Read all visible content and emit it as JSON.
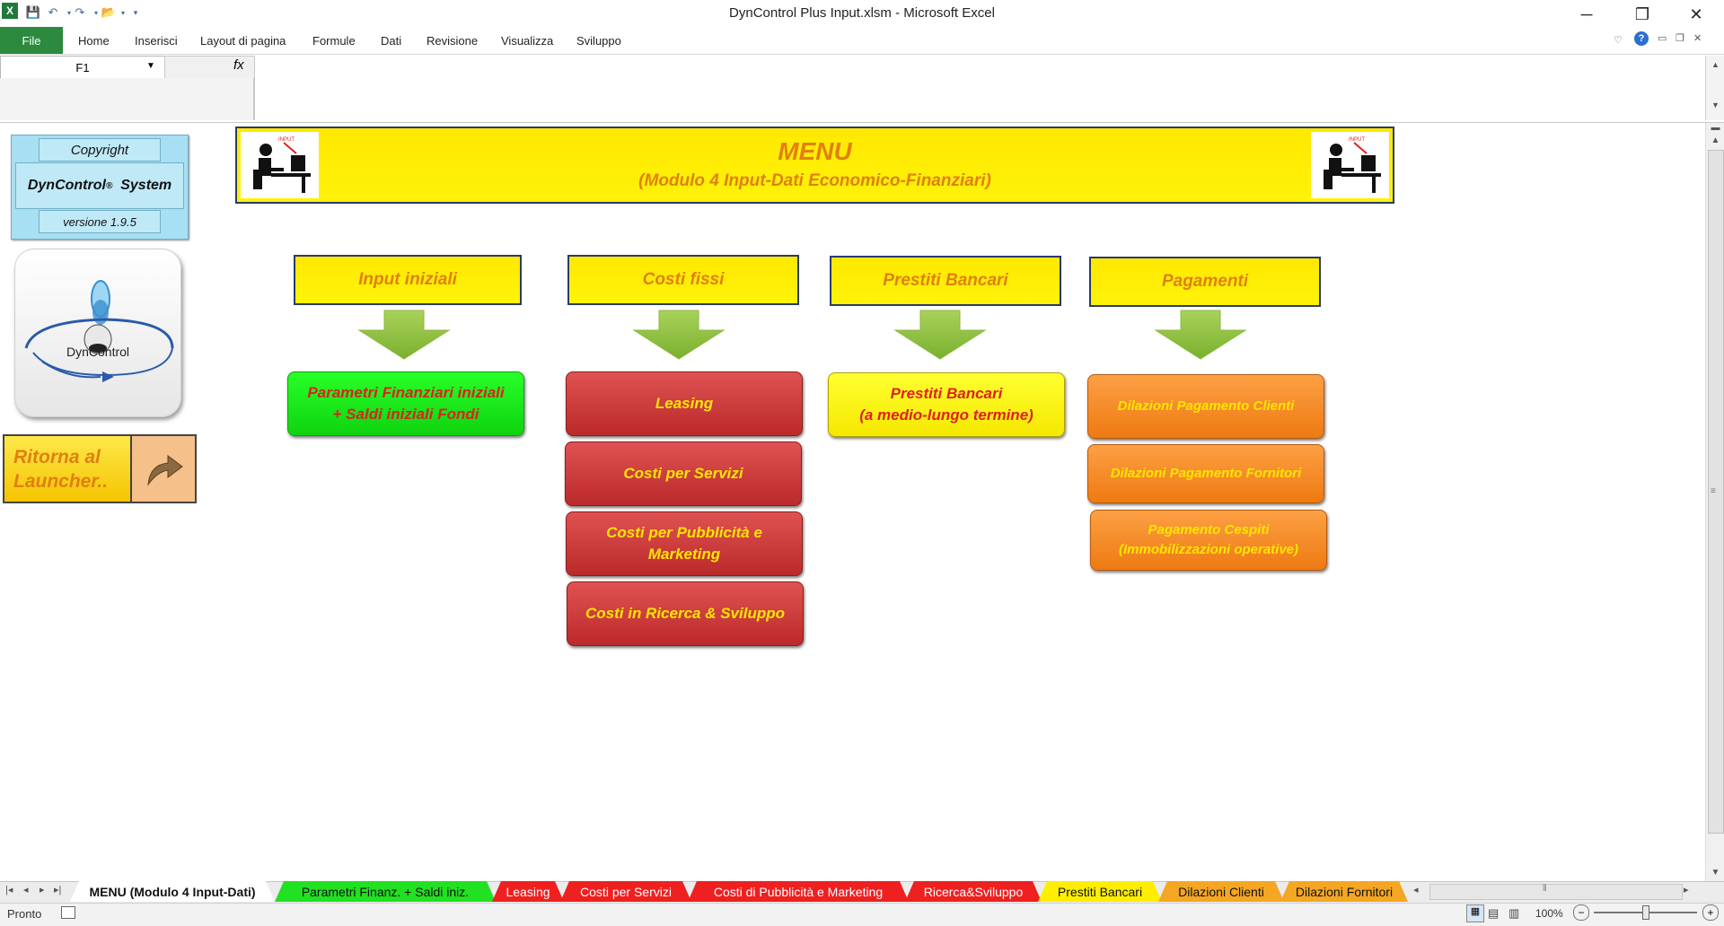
{
  "window": {
    "title": "DynControl Plus Input.xlsm  -  Microsoft Excel",
    "minimize": "─",
    "restore": "❐",
    "close": "✕"
  },
  "quick_access": [
    "save-icon",
    "undo-icon",
    "redo-icon",
    "open-icon",
    "customize-icon"
  ],
  "ribbon": {
    "file_tab": "File",
    "tabs": [
      "Home",
      "Inserisci",
      "Layout di pagina",
      "Formule",
      "Dati",
      "Revisione",
      "Visualizza",
      "Sviluppo"
    ]
  },
  "formula_bar": {
    "name_box": "F1",
    "fx_label": "fx",
    "formula": ""
  },
  "copyright": {
    "label": "Copyright",
    "product": "DynControl",
    "reg": "®",
    "system": "System",
    "version": "versione 1.9.5"
  },
  "logo": {
    "text": "DynControl"
  },
  "ritorna": {
    "line1": "Ritorna al",
    "line2": "Launcher.."
  },
  "header": {
    "title": "MENU",
    "subtitle": "(Modulo 4 Input-Dati Economico-Finanziari)"
  },
  "categories": {
    "input": "Input iniziali",
    "costi": "Costi fissi",
    "prestiti": "Prestiti Bancari",
    "pagamenti": "Pagamenti"
  },
  "buttons": {
    "parametri_l1": "Parametri Finanziari iniziali",
    "parametri_l2": "+ Saldi iniziali Fondi",
    "leasing": "Leasing",
    "servizi": "Costi per Servizi",
    "pubblicita_l1": "Costi per Pubblicità e",
    "pubblicita_l2": "Marketing",
    "ricerca": "Costi in Ricerca & Sviluppo",
    "prestiti_l1": "Prestiti Bancari",
    "prestiti_l2": "(a medio-lungo termine)",
    "dil_clienti": "Dilazioni  Pagamento Clienti",
    "dil_fornitori": "Dilazioni  Pagamento Fornitori",
    "cespiti_l1": "Pagamento Cespiti",
    "cespiti_l2": "(Immobilizzazioni  operative)"
  },
  "sheet_tabs": [
    {
      "label": "MENU (Modulo 4 Input-Dati)",
      "color": "#ffffff"
    },
    {
      "label": "Parametri Finanz. + Saldi iniz.",
      "color": "#22e022"
    },
    {
      "label": "Leasing",
      "color": "#ee2020"
    },
    {
      "label": "Costi per Servizi",
      "color": "#ee2020"
    },
    {
      "label": "Costi di Pubblicità e Marketing",
      "color": "#ee2020"
    },
    {
      "label": "Ricerca&Sviluppo",
      "color": "#ee2020"
    },
    {
      "label": "Prestiti Bancari",
      "color": "#ffee00"
    },
    {
      "label": "Dilazioni Clienti",
      "color": "#f5a623"
    },
    {
      "label": "Dilazioni Fornitori",
      "color": "#f5a623"
    }
  ],
  "status": {
    "ready": "Pronto",
    "zoom": "100%"
  }
}
